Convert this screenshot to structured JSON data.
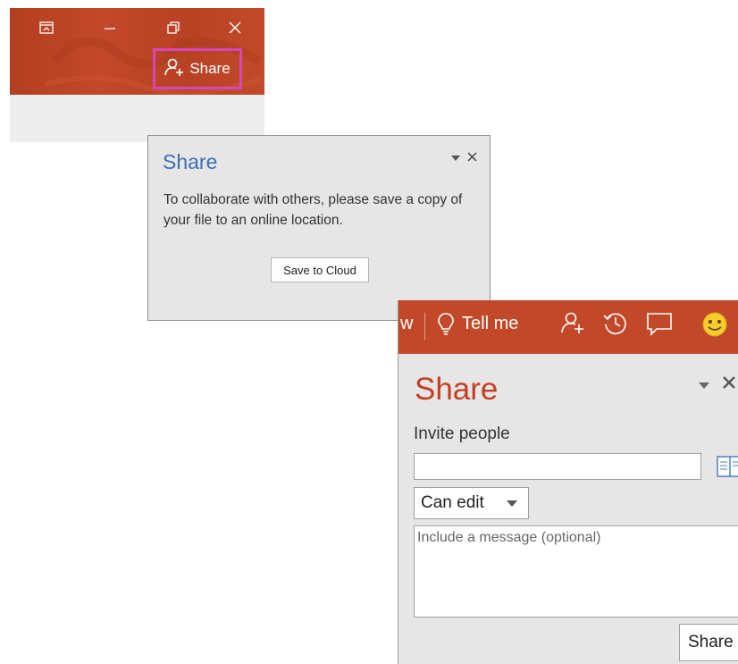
{
  "titlebar": {
    "share_label": "Share",
    "buttons": [
      "ribbon-display-icon",
      "minimize-icon",
      "restore-icon",
      "close-icon"
    ],
    "accent_color": "#c2482a",
    "highlight_color": "#d845b8"
  },
  "share_pane_small": {
    "title": "Share",
    "description": "To collaborate with others, please save a copy of your file to an online location.",
    "save_button": "Save to Cloud",
    "title_color": "#3b6fb0"
  },
  "share_pane_large": {
    "toolbar": {
      "partial_tab": "w",
      "tell_me": "Tell me",
      "icons": [
        "share-person-icon",
        "history-icon",
        "comments-icon",
        "smiley-icon"
      ]
    },
    "title": "Share",
    "invite_label": "Invite people",
    "invite_value": "",
    "permission": "Can edit",
    "message_placeholder": "Include a message (optional)",
    "share_button": "Share",
    "title_color": "#c43f22"
  }
}
